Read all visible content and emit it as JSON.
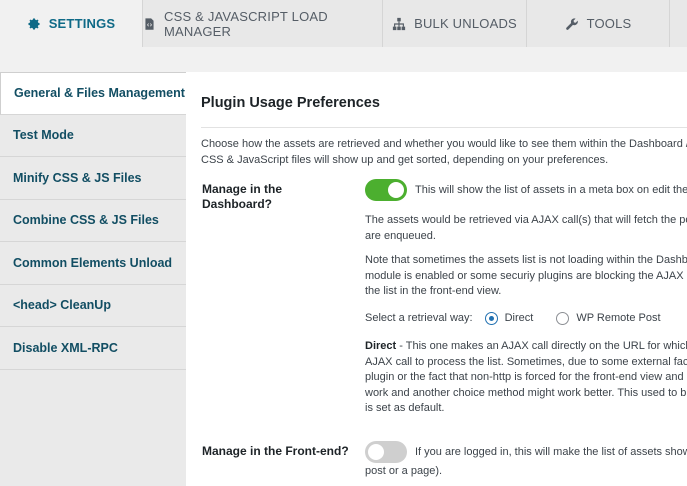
{
  "tabs": [
    {
      "label": "Settings",
      "icon": "gear-icon"
    },
    {
      "label": "CSS & JavaScript Load Manager",
      "icon": "code-file-icon"
    },
    {
      "label": "Bulk Unloads",
      "icon": "sitemap-icon"
    },
    {
      "label": "Tools",
      "icon": "wrench-icon"
    }
  ],
  "sidebar": {
    "items": [
      {
        "label": "General & Files Management"
      },
      {
        "label": "Test Mode"
      },
      {
        "label": "Minify CSS & JS Files"
      },
      {
        "label": "Combine CSS & JS Files"
      },
      {
        "label": "Common Elements Unload"
      },
      {
        "label": "<head> CleanUp"
      },
      {
        "label": "Disable XML-RPC"
      }
    ]
  },
  "main": {
    "title": "Plugin Usage Preferences",
    "intro_line1": "Choose how the assets are retrieved and whether you would like to see them within the Dashboard /",
    "intro_line2": "CSS & JavaScript files will show up and get sorted, depending on your preferences.",
    "dashboard": {
      "label_line1": "Manage in the",
      "label_line2": "Dashboard?",
      "toggle_on": true,
      "desc": "This will show the list of assets in a meta box on edit the",
      "p1_line1": "The assets would be retrieved via AJAX call(s) that will fetch the po",
      "p1_line2": "are enqueued.",
      "p2_line1": "Note that sometimes the assets list is not loading within the Dashb",
      "p2_line2": "module is enabled or some securiy plugins are blocking the AJAX r",
      "p2_line3": "the list in the front-end view.",
      "retrieval_label": "Select a retrieval way:",
      "option_direct": "Direct",
      "option_remote": "WP Remote Post",
      "direct_bold": "Direct",
      "direct_line1": " - This one makes an AJAX call directly on the URL for which",
      "direct_line2": "AJAX call to process the list. Sometimes, due to some external fact",
      "direct_line3": "plugin or the fact that non-http is forced for the front-end view and",
      "direct_line4": "work and another choice method might work better. This used to b",
      "direct_line5": "is set as default."
    },
    "frontend": {
      "label": "Manage in the Front-end?",
      "toggle_on": false,
      "desc_line1": "If you are logged in, this will make the list of assets show",
      "desc_line2": "post or a page)."
    }
  },
  "colors": {
    "accent": "#0f6a87",
    "toggle_on": "#4caf2f",
    "toggle_off": "#cfcfcf",
    "radio": "#2271b1"
  }
}
